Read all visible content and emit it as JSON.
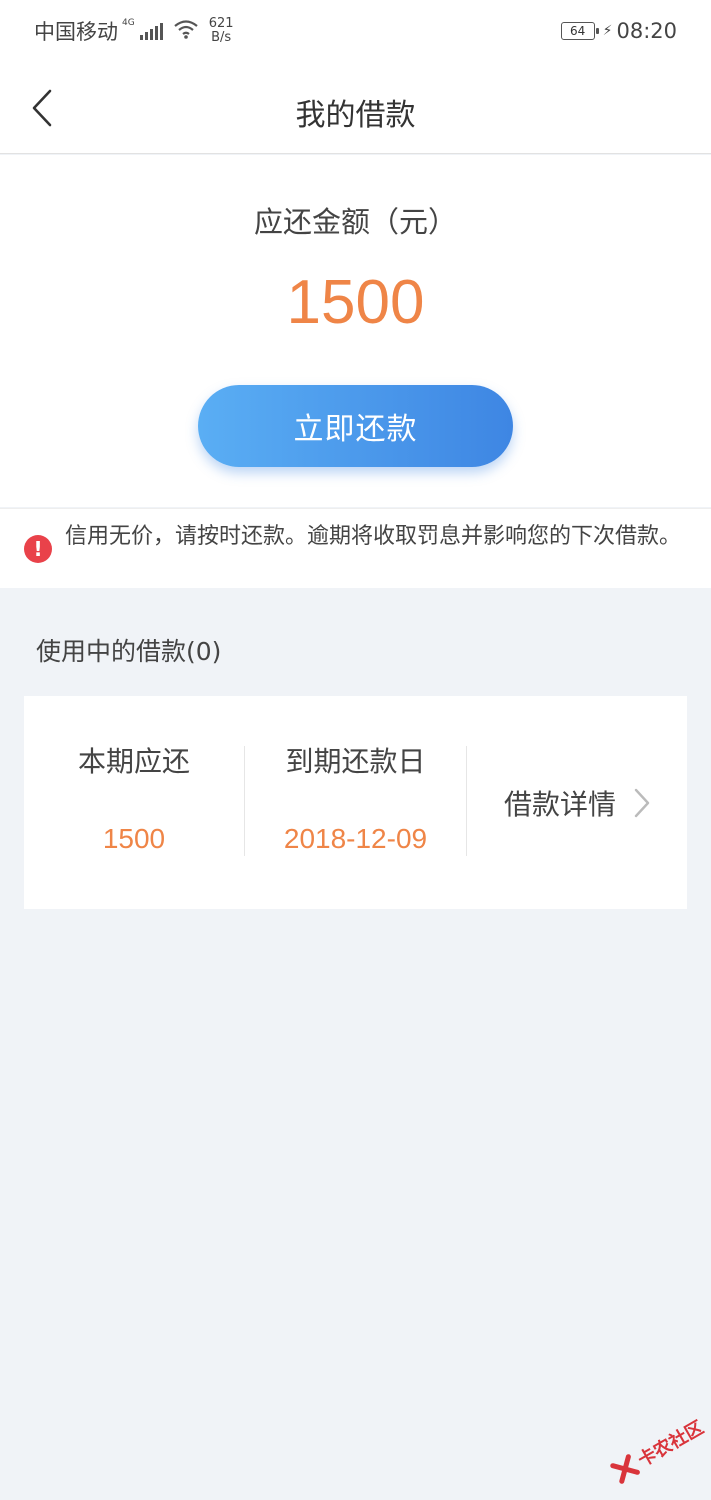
{
  "status_bar": {
    "carrier": "中国移动",
    "network": "4G",
    "speed_value": "621",
    "speed_unit": "B/s",
    "battery": "64",
    "time": "08:20"
  },
  "header": {
    "title": "我的借款"
  },
  "amount": {
    "label": "应还金额（元）",
    "value": "1500",
    "repay_button": "立即还款"
  },
  "notice": {
    "text": "信用无价，请按时还款。逾期将收取罚息并影响您的下次借款。"
  },
  "loans": {
    "section_title": "使用中的借款(0)",
    "card": {
      "due_label": "本期应还",
      "due_value": "1500",
      "date_label": "到期还款日",
      "date_value": "2018-12-09",
      "details_label": "借款详情"
    }
  },
  "watermark": {
    "text": "卡农社区"
  },
  "colors": {
    "accent_orange": "#ef8547",
    "button_blue": "#4a97eb",
    "alert_red": "#e9424a",
    "page_background": "#f0f3f7"
  }
}
